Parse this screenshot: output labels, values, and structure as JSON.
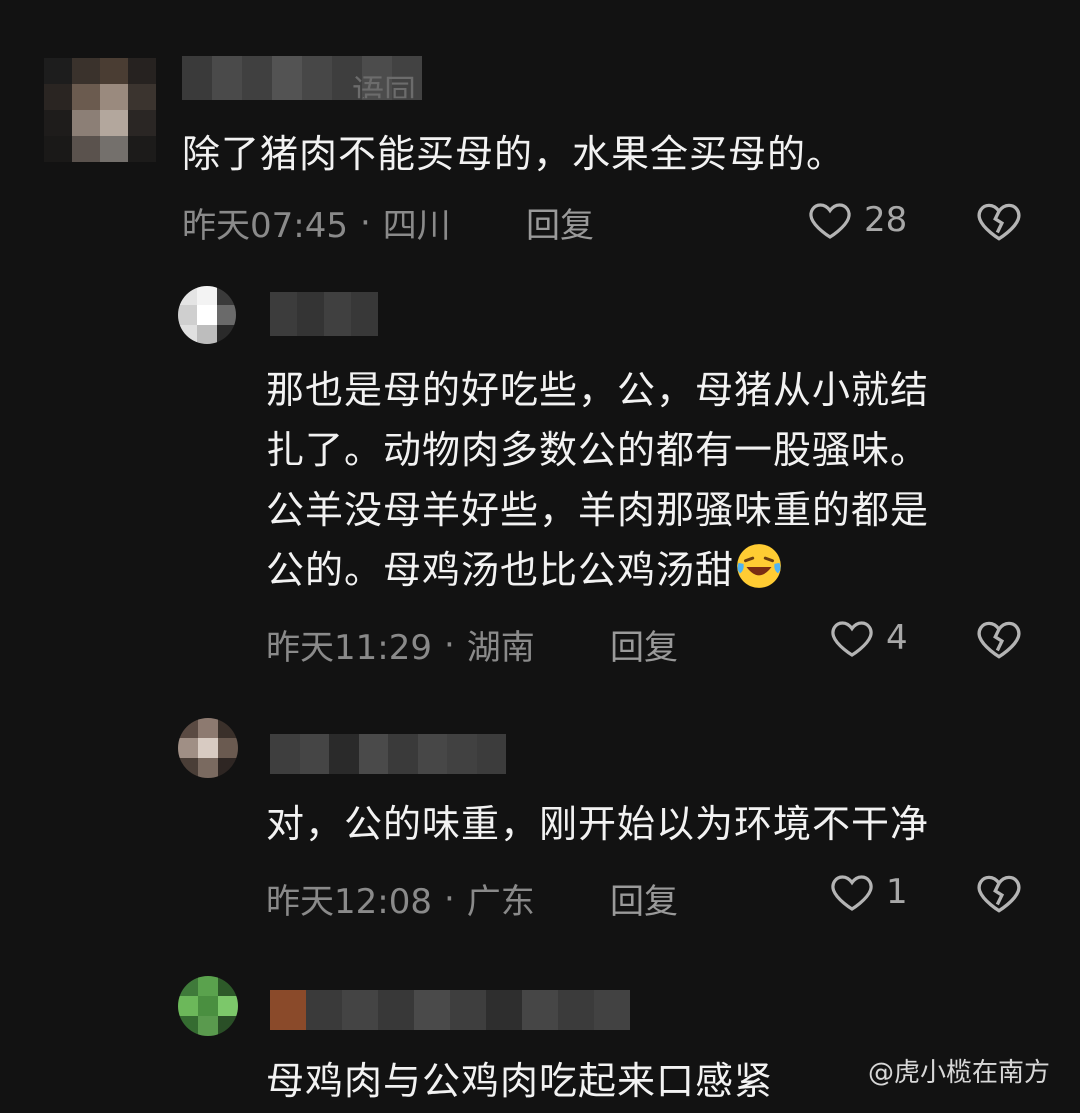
{
  "comments": [
    {
      "user_suffix": "语同",
      "text": "除了猪肉不能买母的，水果全买母的。",
      "time": "昨天07:45",
      "location": "四川",
      "reply_label": "回复",
      "likes": "28"
    },
    {
      "text_lines": [
        "那也是母的好吃些，公，母猪从小就结",
        "扎了。动物肉多数公的都有一股骚味。",
        "公羊没母羊好些，羊肉那骚味重的都是",
        "公的。母鸡汤也比公鸡汤甜"
      ],
      "time": "昨天11:29",
      "location": "湖南",
      "reply_label": "回复",
      "likes": "4"
    },
    {
      "text": "对，公的味重，刚开始以为环境不干净",
      "time": "昨天12:08",
      "location": "广东",
      "reply_label": "回复",
      "likes": "1"
    },
    {
      "text": "母鸡肉与公鸡肉吃起来口感紧"
    }
  ],
  "separator": "·",
  "watermark": "@虎小榄在南方",
  "icons": {
    "like": "heart-outline-icon",
    "dislike": "broken-heart-icon",
    "emoji": "laughing-crying-emoji"
  },
  "colors": {
    "background": "#121212",
    "text": "#f2f2f2",
    "meta": "#8a8a8a"
  }
}
